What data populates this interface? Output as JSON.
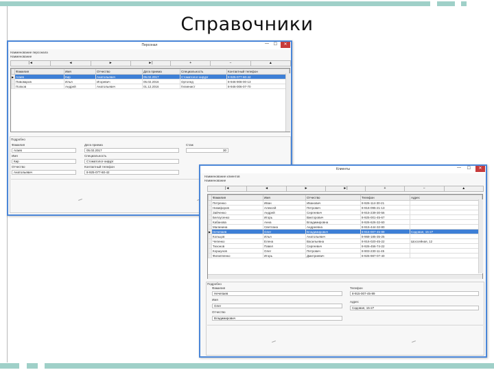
{
  "slide": {
    "title": "Справочники"
  },
  "colors": {
    "accent_bar": "#9fd0c8",
    "window_border": "#4a86d8",
    "selection": "#3d7fd6",
    "close": "#c73b3b"
  },
  "win1": {
    "title": "Персонал",
    "header_lines": [
      "Наименование персонала",
      "Наименование"
    ],
    "nav": [
      "|◄",
      "◄",
      "►",
      "►|",
      "+",
      "−",
      "▲"
    ],
    "columns": [
      "Фамилия",
      "Имя",
      "Отчество",
      "Дата приема",
      "Специальность",
      "Контактный телефон"
    ],
    "rows": [
      {
        "sel": true,
        "cells": [
          "Агаев",
          "Кир",
          "Анатольевич",
          "05.02.2017",
          "Стоматолог-хирург",
          "8-925-077-60-42"
        ]
      },
      {
        "sel": false,
        "cells": [
          "Пивоваров",
          "Илья",
          "Игоревич",
          "05.02.2016",
          "Ортопед",
          "8-946-908-00-13"
        ]
      },
      {
        "sel": false,
        "cells": [
          "Попков",
          "Андрей",
          "Анатольевич",
          "01.12.2016",
          "Гигиенист",
          "8-946-006-07-70"
        ]
      }
    ],
    "detail": {
      "section": "Подробно",
      "f1_label": "Фамилия",
      "f1_value": "Агаев",
      "f2_label": "Имя",
      "f2_value": "Кир",
      "f3_label": "Отчество",
      "f3_value": "Анатольевич",
      "f4_label": "Дата приема",
      "f4_value": "05.02.2017",
      "f5_label": "Специальность",
      "f5_value": "Стоматолог-хирург",
      "f6_label": "Контактный телефон",
      "f6_value": "8-925-077-60-42",
      "f7_label": "Стаж",
      "f7_value": "30"
    }
  },
  "win2": {
    "title": "Клиенты",
    "header_lines": [
      "Наименование клиентов",
      "Наименование"
    ],
    "nav": [
      "|◄",
      "◄",
      "►",
      "►|",
      "+",
      "−",
      "▲"
    ],
    "columns": [
      "Фамилия",
      "Имя",
      "Отчество",
      "Телефон",
      "Адрес"
    ],
    "rows": [
      {
        "sel": false,
        "cells": [
          "Петренко",
          "Иван",
          "Иванович",
          "8-926-114-30-21",
          ""
        ]
      },
      {
        "sel": false,
        "cells": [
          "Никифоров",
          "Алексей",
          "Петрович",
          "8-916-095-21-13",
          ""
        ]
      },
      {
        "sel": false,
        "cells": [
          "Зайченко",
          "Андрей",
          "Сергеевич",
          "8-915-239-30-56",
          ""
        ]
      },
      {
        "sel": false,
        "cells": [
          "Белоусенко",
          "Игорь",
          "Викторович",
          "8-925-001-45-67",
          ""
        ]
      },
      {
        "sel": false,
        "cells": [
          "Кабанова",
          "Анна",
          "Владимировна",
          "8-926-626-32-60",
          ""
        ]
      },
      {
        "sel": false,
        "cells": [
          "Малинина",
          "Светлана",
          "Андреевна",
          "8-915-444-32-80",
          ""
        ]
      },
      {
        "sel": true,
        "cells": [
          "Нечепаев",
          "Олег",
          "Владимирович",
          "8-915-007-45-89",
          "Садовая, 15-27"
        ]
      },
      {
        "sel": false,
        "cells": [
          "Кольцов",
          "Илья",
          "Анатольевич",
          "8-968-185-35-25",
          ""
        ]
      },
      {
        "sel": false,
        "cells": [
          "Чепенко",
          "Елена",
          "Васильевна",
          "8-916-020-45-22",
          "Шоссейная, 12"
        ]
      },
      {
        "sel": false,
        "cells": [
          "Тихонов",
          "Павел",
          "Сергеевич",
          "8-926-456-74-22",
          ""
        ]
      },
      {
        "sel": false,
        "cells": [
          "Коршунов",
          "Олег",
          "Петрович",
          "8-903-230-11-45",
          ""
        ]
      },
      {
        "sel": false,
        "cells": [
          "Филиппенко",
          "Игорь",
          "Дмитриевич",
          "8-926-987-07-40",
          ""
        ]
      }
    ],
    "detail": {
      "section": "Подробно",
      "f1_label": "Фамилия",
      "f1_value": "Нечепаев",
      "f2_label": "Имя",
      "f2_value": "Олег",
      "f3_label": "Отчество",
      "f3_value": "Владимирович",
      "f4_label": "Телефон",
      "f4_value": "8-915-007-45-89",
      "f5_label": "Адрес",
      "f5_value": "Садовая, 15-27"
    }
  }
}
